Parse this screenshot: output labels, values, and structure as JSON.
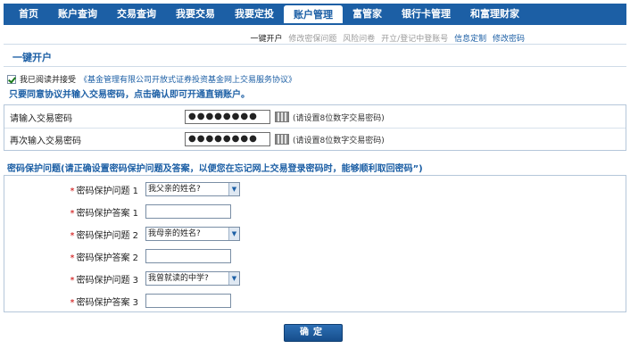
{
  "nav": {
    "items": [
      {
        "label": "首页",
        "active": false
      },
      {
        "label": "账户查询",
        "active": false
      },
      {
        "label": "交易查询",
        "active": false
      },
      {
        "label": "我要交易",
        "active": false
      },
      {
        "label": "我要定投",
        "active": false
      },
      {
        "label": "账户管理",
        "active": true
      },
      {
        "label": "富管家",
        "active": false
      },
      {
        "label": "银行卡管理",
        "active": false
      },
      {
        "label": "和富理财家",
        "active": false
      }
    ]
  },
  "subnav": {
    "items": [
      {
        "label": "一键开户",
        "state": "on"
      },
      {
        "label": "修改密保问题",
        "state": "dim"
      },
      {
        "label": "风险问卷",
        "state": "dim"
      },
      {
        "label": "开立/登记中登账号",
        "state": "dim"
      },
      {
        "label": "信息定制",
        "state": "link"
      },
      {
        "label": "修改密码",
        "state": "link"
      }
    ]
  },
  "section": {
    "title": "一键开户"
  },
  "agreement": {
    "prefix": "我已阅读并接受",
    "link": "《基金管理有限公司开放式证券投资基金网上交易服务协议》",
    "checked": true
  },
  "notice": "只要同意协议并输入交易密码，点击确认即可开通直销账户。",
  "password": {
    "rows": [
      {
        "label": "请输入交易密码",
        "value": "●●●●●●●●",
        "hint": "(请设置8位数字交易密码)"
      },
      {
        "label": "再次输入交易密码",
        "value": "●●●●●●●●",
        "hint": "(请设置8位数字交易密码)"
      }
    ]
  },
  "security": {
    "title": "密码保护问题(请正确设置密码保护问题及答案，以便您在忘记网上交易登录密码时，能够顺利取回密码”)",
    "rows": [
      {
        "kind": "question",
        "label": "密码保护问题 1",
        "value": "我父亲的姓名?"
      },
      {
        "kind": "answer",
        "label": "密码保护答案 1",
        "value": ""
      },
      {
        "kind": "question",
        "label": "密码保护问题 2",
        "value": "我母亲的姓名?"
      },
      {
        "kind": "answer",
        "label": "密码保护答案 2",
        "value": ""
      },
      {
        "kind": "question",
        "label": "密码保护问题 3",
        "value": "我曾就读的中学?"
      },
      {
        "kind": "answer",
        "label": "密码保护答案 3",
        "value": ""
      }
    ],
    "required_mark": "*"
  },
  "confirm": {
    "label": "确定"
  },
  "colors": {
    "brand": "#1c5fa5",
    "required": "#cc0000"
  }
}
